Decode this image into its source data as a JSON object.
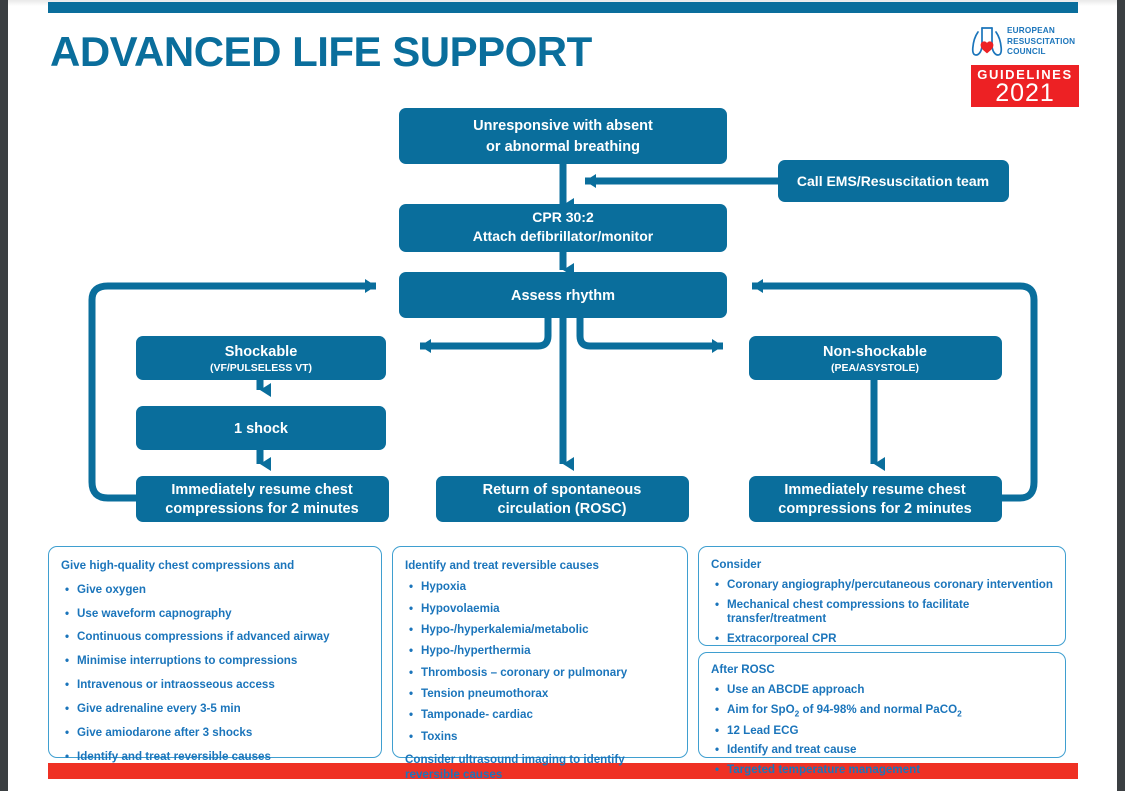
{
  "poster": {
    "title": "ADVANCED LIFE SUPPORT",
    "accent_color": "#0a6e9c",
    "text_blue": "#1b75bb",
    "red": "#ef3124"
  },
  "logo": {
    "line1": "EUROPEAN",
    "line2": "RESUSCITATION",
    "line3": "COUNCIL",
    "guidelines": "GUIDELINES",
    "year": "2021",
    "mark": "lungs-heart-icon"
  },
  "flowchart": {
    "nodes": {
      "unresponsive": {
        "line1": "Unresponsive with absent",
        "line2": "or abnormal breathing"
      },
      "call_ems": {
        "line1": "Call EMS/Resuscitation team"
      },
      "cpr": {
        "line1": "CPR 30:2",
        "line2": "Attach defibrillator/monitor"
      },
      "assess": {
        "line1": "Assess rhythm"
      },
      "shockable": {
        "line1": "Shockable",
        "line2": "(VF/PULSELESS VT)"
      },
      "nonshockable": {
        "line1": "Non-shockable",
        "line2": "(PEA/ASYSTOLE)"
      },
      "shock": {
        "line1": "1 shock"
      },
      "resume_left": {
        "line1": "Immediately resume chest",
        "line2": "compressions for 2 minutes"
      },
      "rosc": {
        "line1": "Return of spontaneous",
        "line2": "circulation (ROSC)"
      },
      "resume_right": {
        "line1": "Immediately resume chest",
        "line2": "compressions for 2 minutes"
      }
    }
  },
  "panels": {
    "cpr_quality": {
      "title": "Give high-quality chest compressions and",
      "items": [
        "Give oxygen",
        "Use waveform capnography",
        "Continuous compressions if advanced airway",
        "Minimise interruptions to compressions",
        "Intravenous or intraosseous access",
        "Give adrenaline every 3-5 min",
        "Give amiodarone after 3 shocks",
        "Identify and treat reversible causes"
      ]
    },
    "reversible_causes": {
      "title": "Identify and treat reversible causes",
      "items": [
        "Hypoxia",
        "Hypovolaemia",
        "Hypo-/hyperkalemia/metabolic",
        "Hypo-/hyperthermia",
        "Thrombosis – coronary or pulmonary",
        "Tension pneumothorax",
        "Tamponade- cardiac",
        "Toxins"
      ],
      "note": "Consider ultrasound imaging to identify reversible causes"
    },
    "consider": {
      "title": "Consider",
      "items": [
        "Coronary angiography/percutaneous coronary intervention",
        "Mechanical chest compressions to facilitate transfer/treatment",
        "Extracorporeal CPR"
      ]
    },
    "after_rosc": {
      "title": "After ROSC",
      "items": [
        "Use an ABCDE approach",
        "Aim for SpO2 of 94-98% and normal PaCO2",
        "12 Lead ECG",
        "Identify and treat cause",
        "Targeted temperature management"
      ],
      "item_spo2_parts": {
        "pre": "Aim for SpO",
        "sub1": "2",
        "mid": " of 94-98% and normal PaCO",
        "sub2": "2"
      }
    }
  }
}
